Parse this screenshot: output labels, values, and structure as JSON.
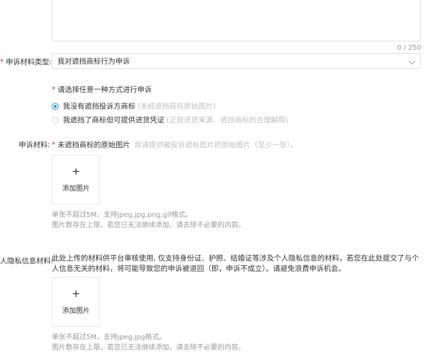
{
  "textarea": {
    "counter": "0 / 250"
  },
  "appeal_type": {
    "label": "申诉材料类型:",
    "selected": "我对遮挡商标行为申诉"
  },
  "method": {
    "title": "请选择任意一种方式进行申诉",
    "options": [
      {
        "label": "我没有遮挡投诉方商标",
        "hint": "(未经遮挡商标原始图片)",
        "selected": true
      },
      {
        "label": "我遮挡了商标但可提供进货凭证",
        "hint": "(正规进货来源、遮挡商标的合理解释)",
        "selected": false
      }
    ]
  },
  "materials": {
    "label": "申诉材料:",
    "title": "未遮挡商标的原始图片",
    "hint": "烦请提供被投诉遮标图片的原始图片（至少一张）。",
    "upload_label": "添加图片",
    "upload_plus": "+",
    "note1": "单张不超过5M，支持jpeg,jpg,png,gif格式。",
    "note2": "图片数存在上限，若您已无法继续添加，请去除不必要的内容。"
  },
  "privacy": {
    "label": "人隐私信息材料:",
    "text": "此处上传的材料供平台审核使用, 仅支持身份证、护照、结婚证等涉及个人隐私信息的材料，若您在此处提交了与个人信息无关的材料，将可能导致您的申诉被退回（即，申诉不成立）。请避免浪费申诉机会。",
    "upload_label": "添加图片",
    "upload_plus": "+",
    "note1": "单张不超过5M，支持jpeg,jpg格式。",
    "note2": "图片数存在上限，若您已无法继续添加，请去除不必要的内容。"
  },
  "colors": {
    "primary": "#1890ff",
    "required": "#f5222d",
    "hint": "#bfbfbf",
    "note": "#999999"
  }
}
